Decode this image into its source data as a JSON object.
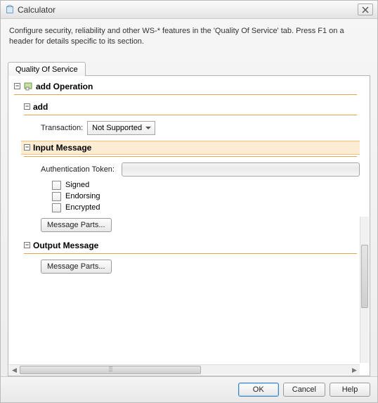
{
  "window": {
    "title": "Calculator"
  },
  "description": "Configure security, reliability and other WS-* features in the 'Quality Of Service' tab. Press F1 on a header for details specific to its section.",
  "tab": {
    "label": "Quality Of Service"
  },
  "operation": {
    "title": "add Operation",
    "binding": {
      "title": "add",
      "transaction_label": "Transaction:",
      "transaction_value": "Not Supported"
    },
    "input": {
      "title": "Input Message",
      "auth_label": "Authentication Token:",
      "auth_value": "",
      "signed_label": "Signed",
      "endorsing_label": "Endorsing",
      "encrypted_label": "Encrypted",
      "message_parts_btn": "Message Parts..."
    },
    "output": {
      "title": "Output Message",
      "message_parts_btn": "Message Parts..."
    }
  },
  "buttons": {
    "ok": "OK",
    "cancel": "Cancel",
    "help": "Help"
  }
}
